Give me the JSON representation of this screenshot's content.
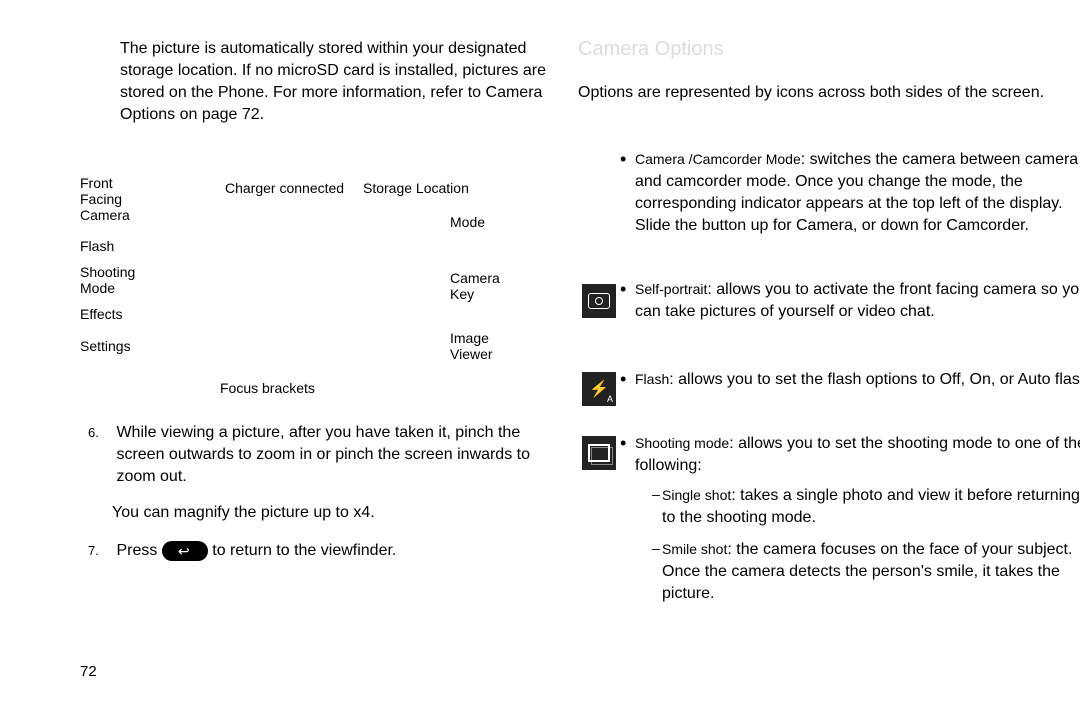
{
  "left": {
    "intro": "The picture is automatically stored within your designated storage location. If no microSD card is installed, pictures are stored on the Phone. For more information, refer to Camera Options on page 72.",
    "diag": {
      "front": "Front Facing Camera",
      "flash": "Flash",
      "shootmode": "Shooting Mode",
      "effects": "Effects",
      "settings": "Settings",
      "focus": "Focus brackets",
      "charger": "Charger connected",
      "storage": "Storage Location",
      "mode": "Mode",
      "camkey": "Camera Key",
      "imgviewer": "Image Viewer"
    },
    "step6": "While viewing a picture, after you have taken it, pinch the screen outwards to zoom in or pinch the screen inwards to zoom out.",
    "step6b": "You can magnify the picture up to x4.",
    "step7a": "Press",
    "step7b": " to return to the viewfinder.",
    "num6": "6.",
    "num7": "7."
  },
  "right": {
    "title": "Camera Options",
    "intro": "Options are represented by icons across both sides of the screen.",
    "cammode_label": "Camera /Camcorder Mode",
    "cammode": ": switches the camera between camera and camcorder mode. Once you change the mode, the corresponding indicator appears at the top left of the display. Slide the button up for Camera, or down for Camcorder.",
    "self_label": "Self-portrait",
    "self": ": allows you to activate the front facing camera so you can take pictures of yourself or video chat.",
    "flash_label": "Flash",
    "flash": ": allows you to set the flash options to Off, On, or Auto flash.",
    "shoot_label": "Shooting mode",
    "shoot": ": allows you to set the shooting mode to one of the following:",
    "single_label": "Single shot",
    "single": ": takes a single photo and view it before returning to the shooting mode.",
    "smile_label": "Smile shot",
    "smile": ": the camera focuses on the face of your subject. Once the camera detects the person's smile, it takes the picture."
  },
  "page_number": "72"
}
